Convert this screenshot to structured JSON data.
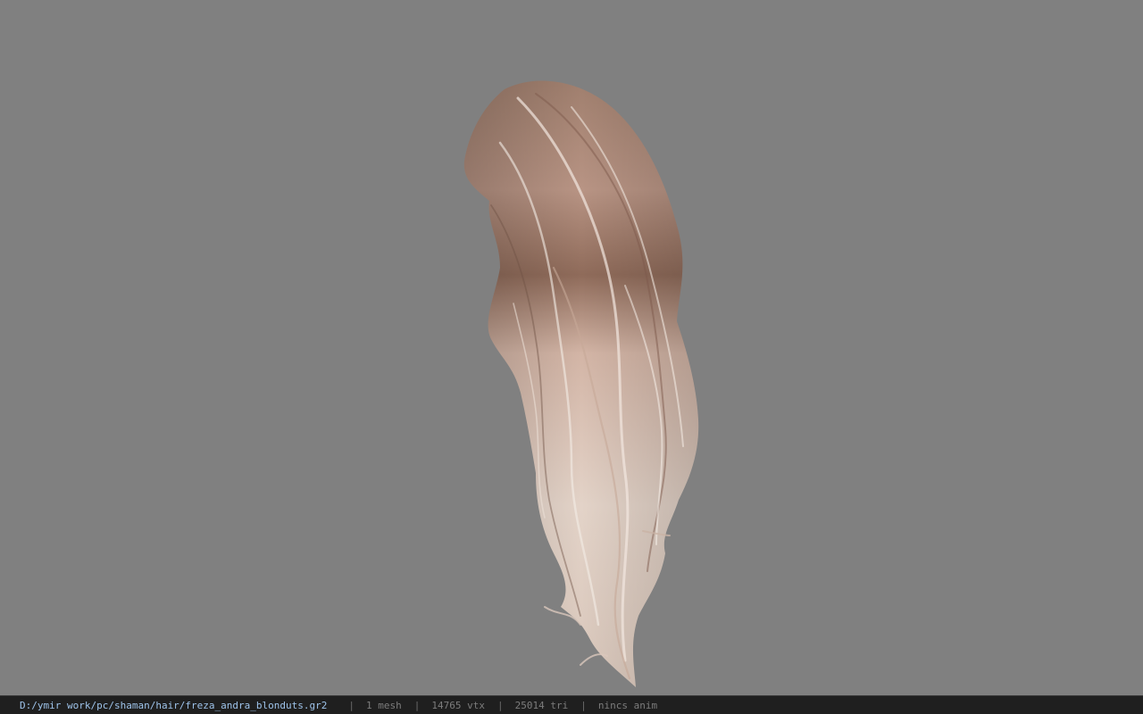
{
  "viewport": {
    "background_color": "#808080",
    "model_description": "hair-mesh"
  },
  "status_bar": {
    "file_path": "D:/ymir work/pc/shaman/hair/freza_andra_blonduts.gr2",
    "separator": "|",
    "mesh_count": "1 mesh",
    "vertex_count": "14765 vtx",
    "triangle_count": "25014 tri",
    "animation_status": "nincs anim",
    "path_color": "#9ec3ea",
    "background_color": "#1f1f1f"
  }
}
